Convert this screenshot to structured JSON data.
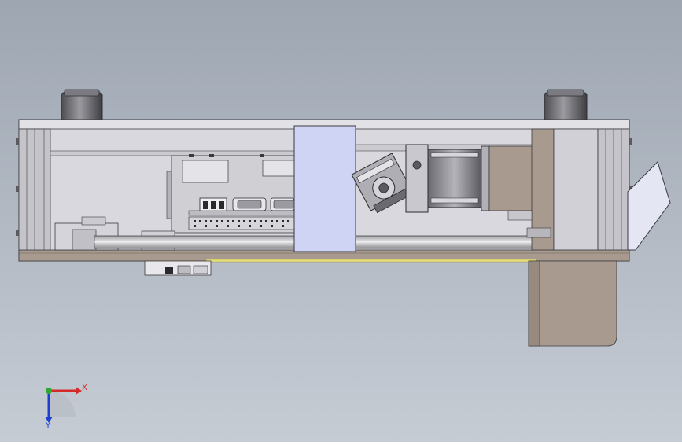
{
  "viewport": {
    "background_top": "#9ea6b2",
    "background_bottom": "#c6ccd4"
  },
  "triad": {
    "x_label": "X",
    "y_label": "Y",
    "x_color": "#d42a2a",
    "y_color": "#1f3fd0",
    "z_color": "#2ea82e"
  },
  "colors": {
    "housing": "#d8d8de",
    "housing_dark": "#a5a5ab",
    "bracket": "#a89a8e",
    "panel_blue": "#cfd4f4",
    "rod": "#c8c9cc"
  }
}
